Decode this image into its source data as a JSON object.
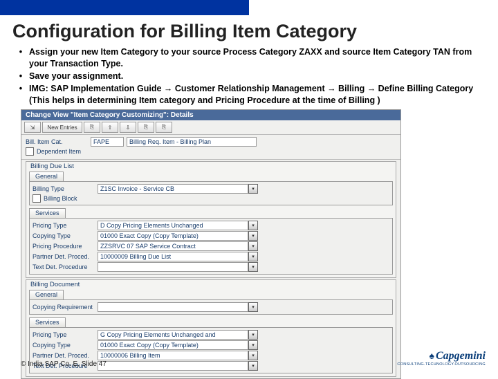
{
  "title": "Configuration for Billing Item Category",
  "bullets": [
    "Assign your new Item Category to your source Process Category ZAXX and source Item Category TAN from your Transaction Type.",
    "Save your assignment.",
    "IMG: SAP Implementation Guide → Customer Relationship Management → Billing → Define Billing Category (This helps in determining Item category and Pricing Procedure at the time of Billing )"
  ],
  "sap": {
    "windowTitle": "Change View \"Item Category Customizing\": Details",
    "toolbar": {
      "expand": "⇲",
      "newEntries": "New Entries",
      "b1": "⎘",
      "b2": "⇧",
      "b3": "⇩",
      "b4": "⎘",
      "b5": "⎘"
    },
    "topFields": {
      "billItemCatLabel": "Bill. Item Cat.",
      "billItemCatCode": "FAPE",
      "billItemCatDesc": "Billing Req. Item - Billing Plan",
      "dependentItemLabel": "Dependent Item"
    },
    "dueList": {
      "title": "Billing Due List",
      "tabGeneral": "General",
      "billingTypeLabel": "Billing Type",
      "billingTypeVal": "Z1SC Invoice - Service CB",
      "billingBlockLabel": "Billing Block",
      "tabServices": "Services",
      "rows": [
        {
          "label": "Pricing Type",
          "val": "D Copy Pricing Elements Unchanged"
        },
        {
          "label": "Copying Type",
          "val": "01000 Exact Copy (Copy Template)"
        },
        {
          "label": "Pricing Procedure",
          "val": "ZZSRVC 07 SAP Service Contract"
        },
        {
          "label": "Partner Det. Proced.",
          "val": "10000009 Billing Due List"
        },
        {
          "label": "Text Det. Procedure",
          "val": ""
        }
      ]
    },
    "billDoc": {
      "title": "Billing Document",
      "tabGeneral": "General",
      "copyReqLabel": "Copying Requirement",
      "tabServices": "Services",
      "rows": [
        {
          "label": "Pricing Type",
          "val": "G Copy Pricing Elements Unchanged and Redetermine Taxes"
        },
        {
          "label": "Copying Type",
          "val": "01000 Exact Copy (Copy Template)"
        },
        {
          "label": "Partner Det. Proced.",
          "val": "10000006 Billing Item"
        },
        {
          "label": "Text Det. Procedure",
          "val": ""
        }
      ]
    }
  },
  "footer": "© India SAP Co. E, Slide 47",
  "logo": {
    "name": "Capgemini",
    "sub": "CONSULTING.TECHNOLOGY.OUTSOURCING"
  }
}
